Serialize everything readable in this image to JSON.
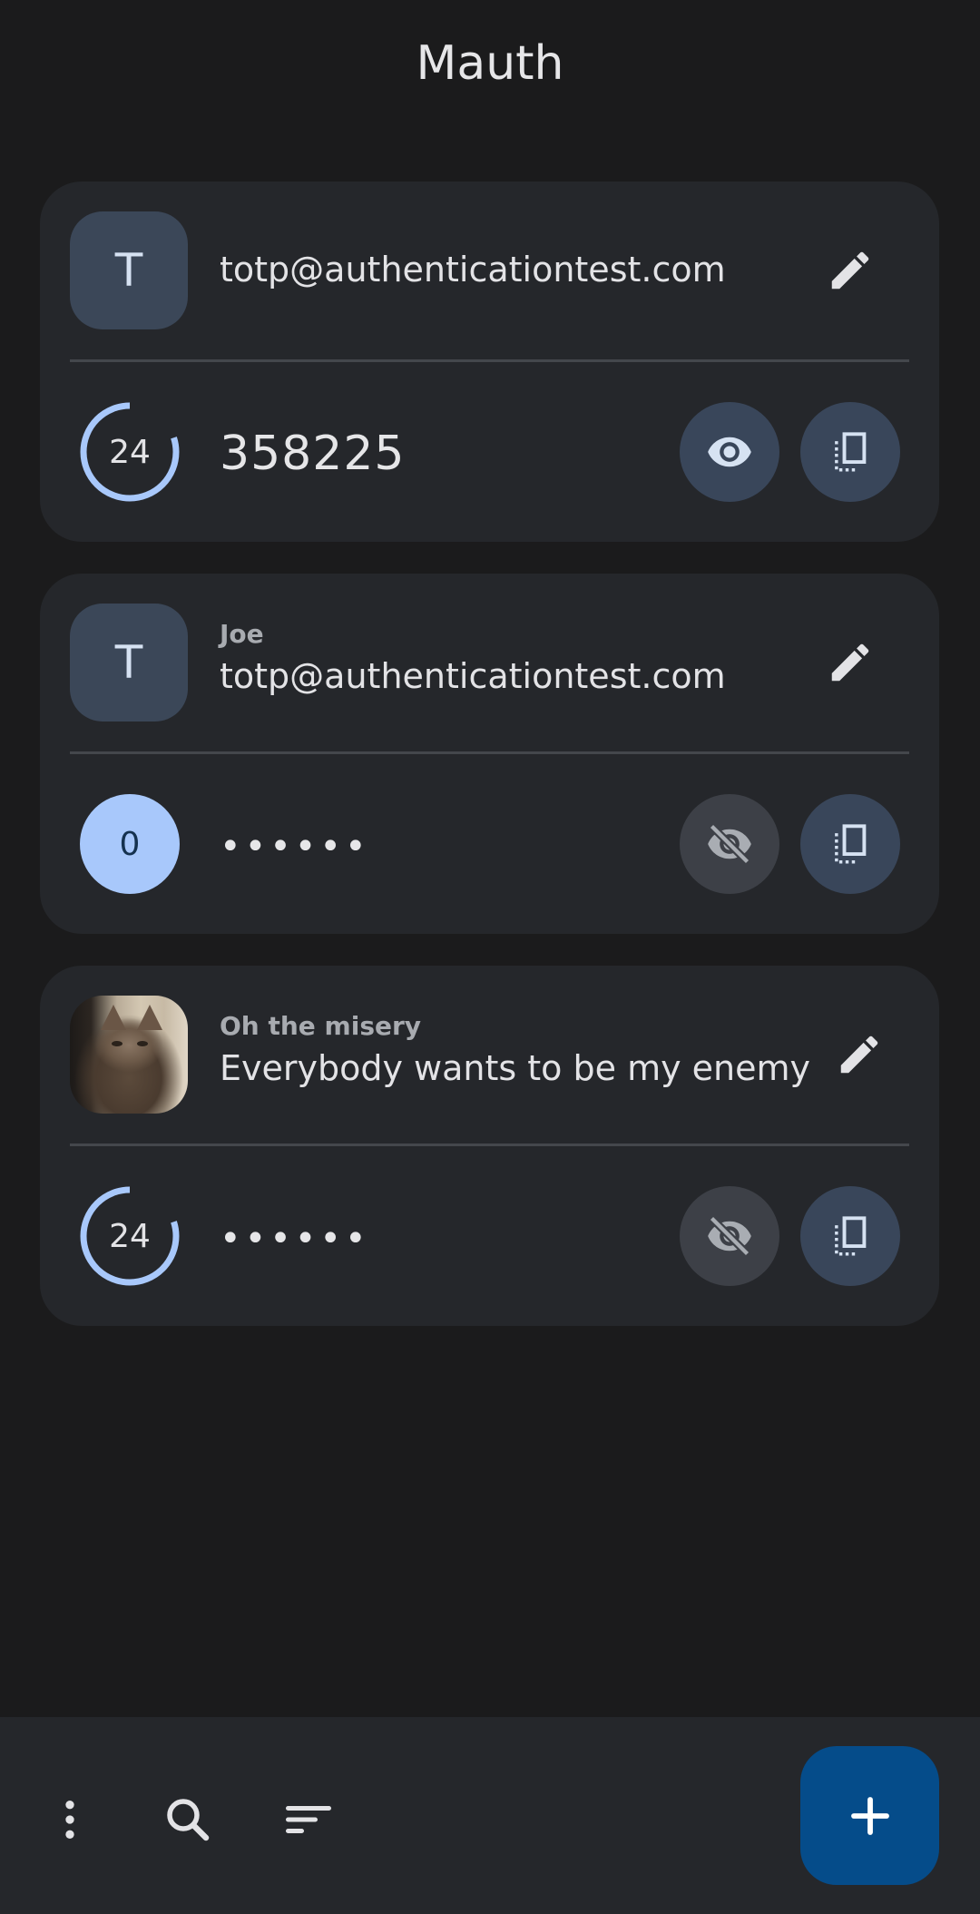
{
  "app": {
    "title": "Mauth"
  },
  "accounts": [
    {
      "avatar_letter": "T",
      "issuer": "",
      "name": "totp@authenticationtest.com",
      "timer": "24",
      "timer_progress": 0.8,
      "code": "358225",
      "code_visible": true
    },
    {
      "avatar_letter": "T",
      "issuer": "Joe",
      "name": "totp@authenticationtest.com",
      "timer": "0",
      "timer_progress": 1.0,
      "code": "••••••",
      "code_visible": false
    },
    {
      "avatar_letter": "",
      "avatar_image": "cat-photo",
      "issuer": "Oh the misery",
      "name": "Everybody wants to be my enemy",
      "timer": "24",
      "timer_progress": 0.8,
      "code": "••••••",
      "code_visible": false
    }
  ],
  "icons": {
    "edit": "pencil-icon",
    "eye": "eye-icon",
    "eye_off": "eye-off-icon",
    "copy": "copy-icon",
    "more": "more-vert-icon",
    "search": "search-icon",
    "sort": "sort-icon",
    "add": "plus-icon"
  },
  "colors": {
    "background": "#1b1b1c",
    "card": "#25272b",
    "accent": "#a8c8fb",
    "fab": "#054c8a"
  }
}
